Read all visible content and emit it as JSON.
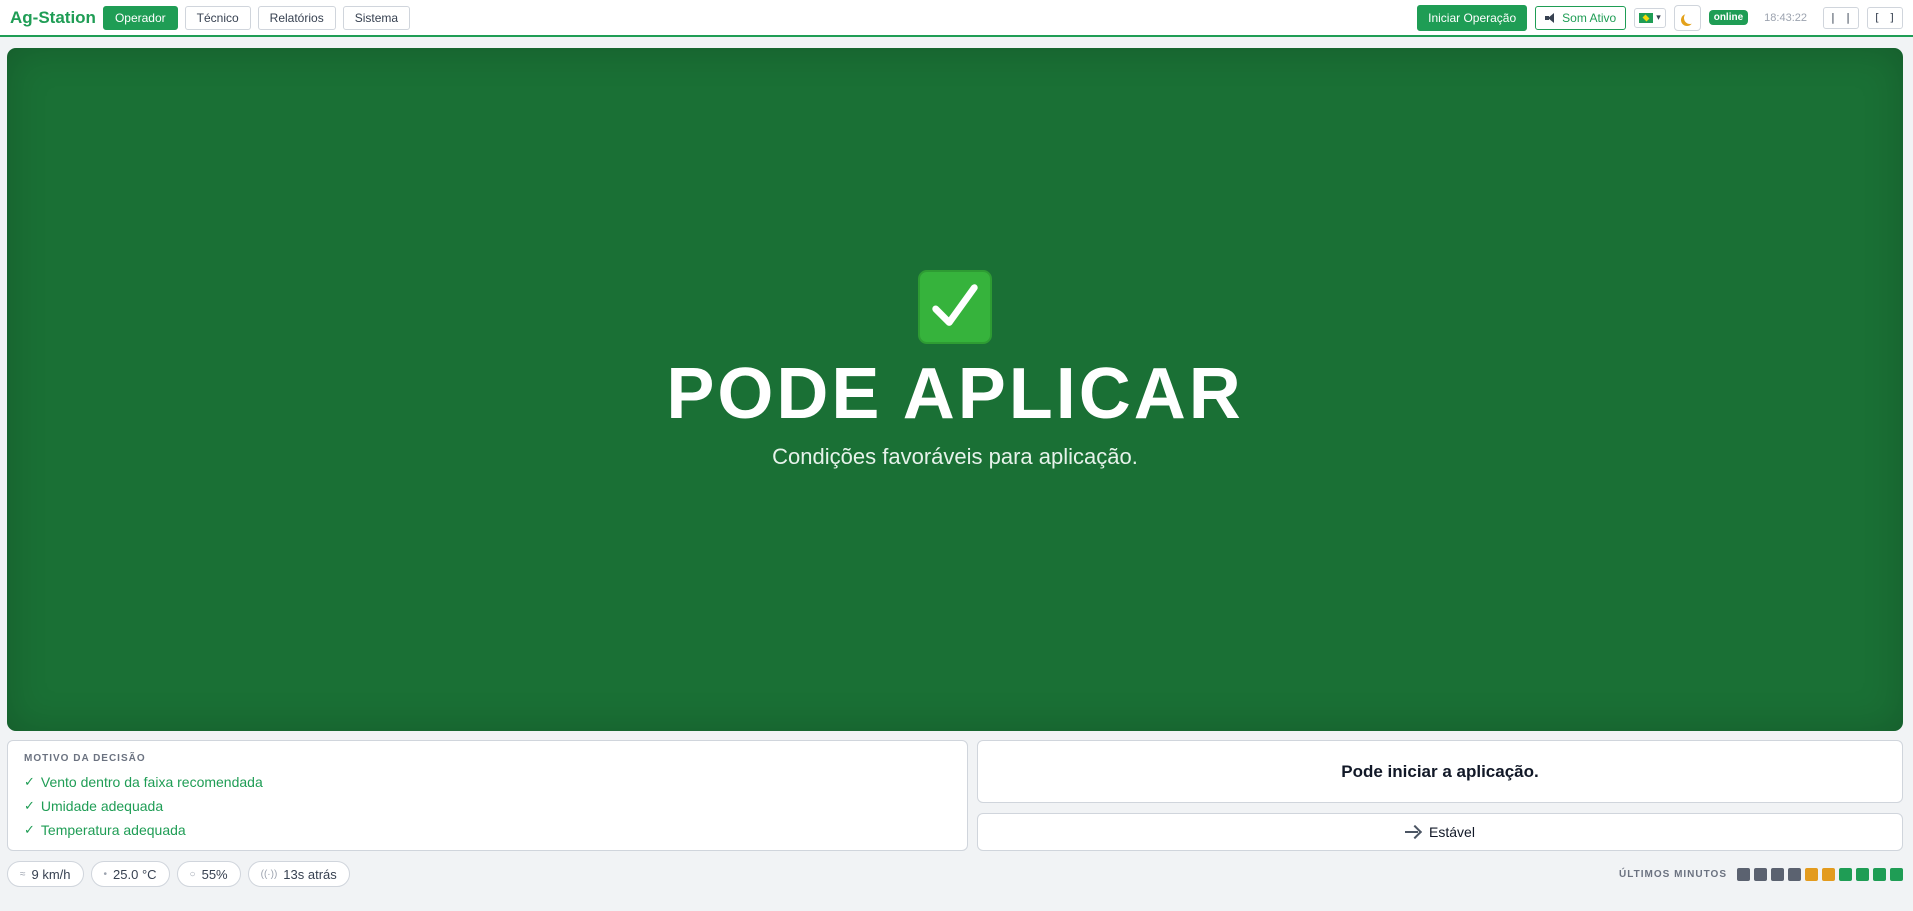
{
  "header": {
    "brand": "Ag-Station",
    "nav": [
      {
        "label": "Operador",
        "active": true
      },
      {
        "label": "Técnico",
        "active": false
      },
      {
        "label": "Relatórios",
        "active": false
      },
      {
        "label": "Sistema",
        "active": false
      }
    ],
    "start_label": "Iniciar Operação",
    "sound_label": "Som Ativo",
    "online_label": "online",
    "clock": "18:43:22",
    "pause_label": "| |",
    "fullscreen_label": "[ ]"
  },
  "status": {
    "title": "PODE APLICAR",
    "subtitle": "Condições favoráveis para aplicação.",
    "color": "#1a7035"
  },
  "reason": {
    "heading": "MOTIVO DA DECISÃO",
    "items": [
      "Vento dentro da faixa recomendada",
      "Umidade adequada",
      "Temperatura adequada"
    ]
  },
  "message": "Pode iniciar a aplicação.",
  "trend": "Estável",
  "footer": {
    "wind": "9 km/h",
    "temperature": "25.0 °C",
    "humidity": "55%",
    "updated": "13s atrás",
    "history_label": "ÚLTIMOS MINUTOS",
    "history": [
      "#5b6270",
      "#5b6270",
      "#5b6270",
      "#5b6270",
      "#e39b1e",
      "#e39b1e",
      "#1f9d55",
      "#1f9d55",
      "#1f9d55",
      "#1f9d55"
    ]
  },
  "colors": {
    "accent": "#1f9d55",
    "warning": "#e39b1e",
    "neutral": "#5b6270"
  }
}
